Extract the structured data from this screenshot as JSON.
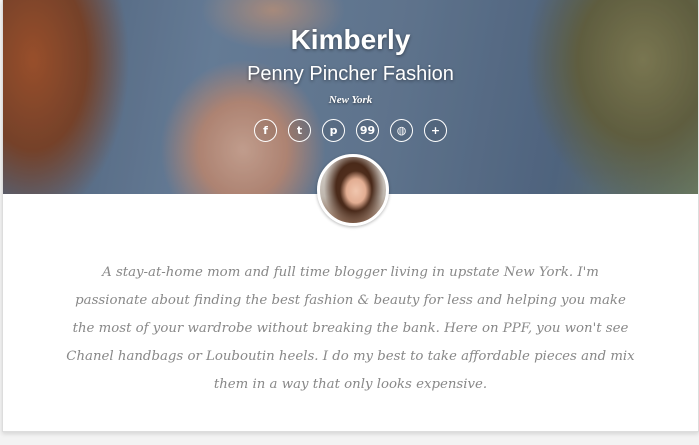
{
  "profile": {
    "name": "Kimberly",
    "blog_name": "Penny Pincher Fashion",
    "location": "New York",
    "bio": "A stay-at-home mom and full time blogger living in upstate New York. I'm passionate about finding the best fashion & beauty for less and helping you make the most of your wardrobe without breaking the bank. Here on PPF, you won't see Chanel handbags or Louboutin heels. I do my best to take affordable pieces and mix them in a way that only looks expensive."
  },
  "social_links": [
    {
      "icon": "facebook-icon",
      "glyph": "f"
    },
    {
      "icon": "twitter-icon",
      "glyph": "t"
    },
    {
      "icon": "pinterest-icon",
      "glyph": "p"
    },
    {
      "icon": "quote-icon",
      "glyph": "99"
    },
    {
      "icon": "globe-icon",
      "glyph": "◍"
    },
    {
      "icon": "bloglovin-icon",
      "glyph": "+"
    }
  ],
  "colors": {
    "header_text": "#ffffff",
    "bio_text": "#888888",
    "card_background": "#ffffff"
  }
}
